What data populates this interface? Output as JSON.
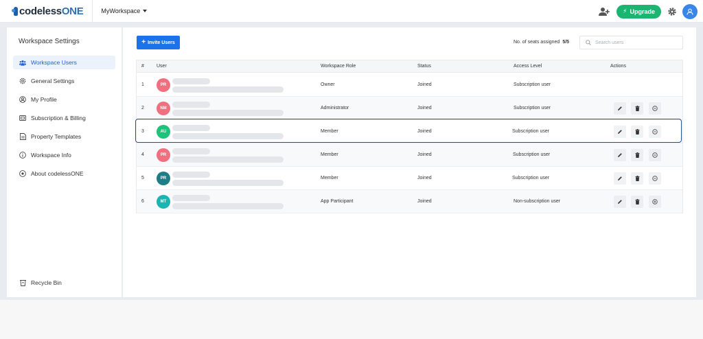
{
  "header": {
    "logo_part1": "codeless",
    "logo_part2": "ONE",
    "workspace": "MyWorkspace",
    "upgrade_label": "Upgrade",
    "icons": [
      "add-user-icon",
      "bolt-icon",
      "gear-icon",
      "user-avatar-icon"
    ],
    "colors": {
      "brand": "#1f5fa8",
      "upgrade": "#1bb471",
      "avatar": "#3a86e8"
    }
  },
  "sidebar": {
    "title": "Workspace Settings",
    "items": [
      {
        "label": "Workspace Users",
        "icon": "users-icon",
        "active": true
      },
      {
        "label": "General Settings",
        "icon": "gear-icon",
        "active": false
      },
      {
        "label": "My Profile",
        "icon": "user-icon",
        "active": false
      },
      {
        "label": "Subscription & Billing",
        "icon": "card-icon",
        "active": false
      },
      {
        "label": "Property Templates",
        "icon": "document-icon",
        "active": false
      },
      {
        "label": "Workspace Info",
        "icon": "info-icon",
        "active": false
      },
      {
        "label": "About codelessONE",
        "icon": "about-icon",
        "active": false
      }
    ],
    "recycle_bin": "Recycle Bin"
  },
  "main": {
    "invite_label": "Invite Users",
    "seats_label": "No. of seats assigned",
    "seats_value": "5/5",
    "search_placeholder": "Search users",
    "columns": [
      "#",
      "User",
      "Workspace Role",
      "Status",
      "Access Level",
      "Actions"
    ],
    "rows": [
      {
        "num": "1",
        "initials": "PR",
        "avatar_color": "#f07080",
        "role": "Owner",
        "status": "Joined",
        "access": "Subscription user",
        "actions": []
      },
      {
        "num": "2",
        "initials": "NM",
        "avatar_color": "#f07080",
        "role": "Administrator",
        "status": "Joined",
        "access": "Subscription user",
        "actions": [
          "edit",
          "delete",
          "minus"
        ]
      },
      {
        "num": "3",
        "initials": "AU",
        "avatar_color": "#1fc27a",
        "role": "Member",
        "status": "Joined",
        "access": "Subscription user",
        "actions": [
          "edit",
          "delete",
          "minus"
        ],
        "selected": true
      },
      {
        "num": "4",
        "initials": "PR",
        "avatar_color": "#f07080",
        "role": "Member",
        "status": "Joined",
        "access": "Subscription user",
        "actions": [
          "edit",
          "delete",
          "minus"
        ]
      },
      {
        "num": "5",
        "initials": "PR",
        "avatar_color": "#1c7f86",
        "role": "Member",
        "status": "Joined",
        "access": "Subscription user",
        "actions": [
          "edit",
          "delete",
          "minus"
        ]
      },
      {
        "num": "6",
        "initials": "MT",
        "avatar_color": "#1ab5b0",
        "role": "App Participant",
        "status": "Joined",
        "access": "Non-subscription user",
        "actions": [
          "edit",
          "delete",
          "plus"
        ]
      }
    ]
  }
}
